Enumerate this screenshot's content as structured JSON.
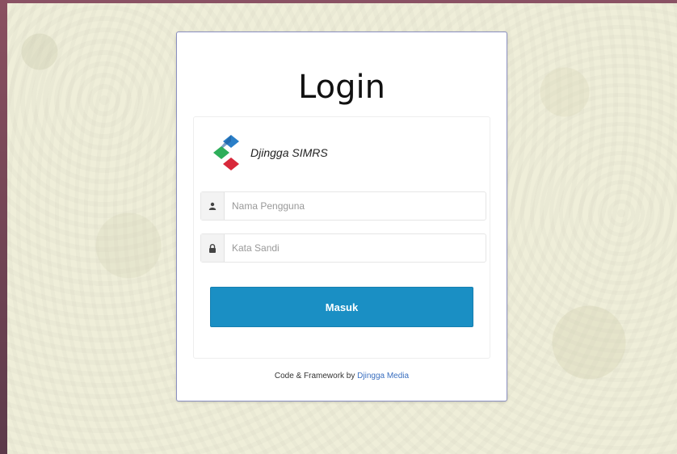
{
  "login": {
    "title": "Login",
    "brand_name": "Djingga SIMRS",
    "username": {
      "placeholder": "Nama Pengguna",
      "value": "",
      "icon": "user-icon"
    },
    "password": {
      "placeholder": "Kata Sandi",
      "value": "",
      "icon": "lock-icon"
    },
    "submit_label": "Masuk"
  },
  "footer": {
    "prefix": "Code & Framework by",
    "link_text": "Djingga Media"
  },
  "colors": {
    "accent": "#1a8fc4",
    "link": "#3a6fbf",
    "background": "#efeed9",
    "card_border": "#8a8fc0"
  }
}
